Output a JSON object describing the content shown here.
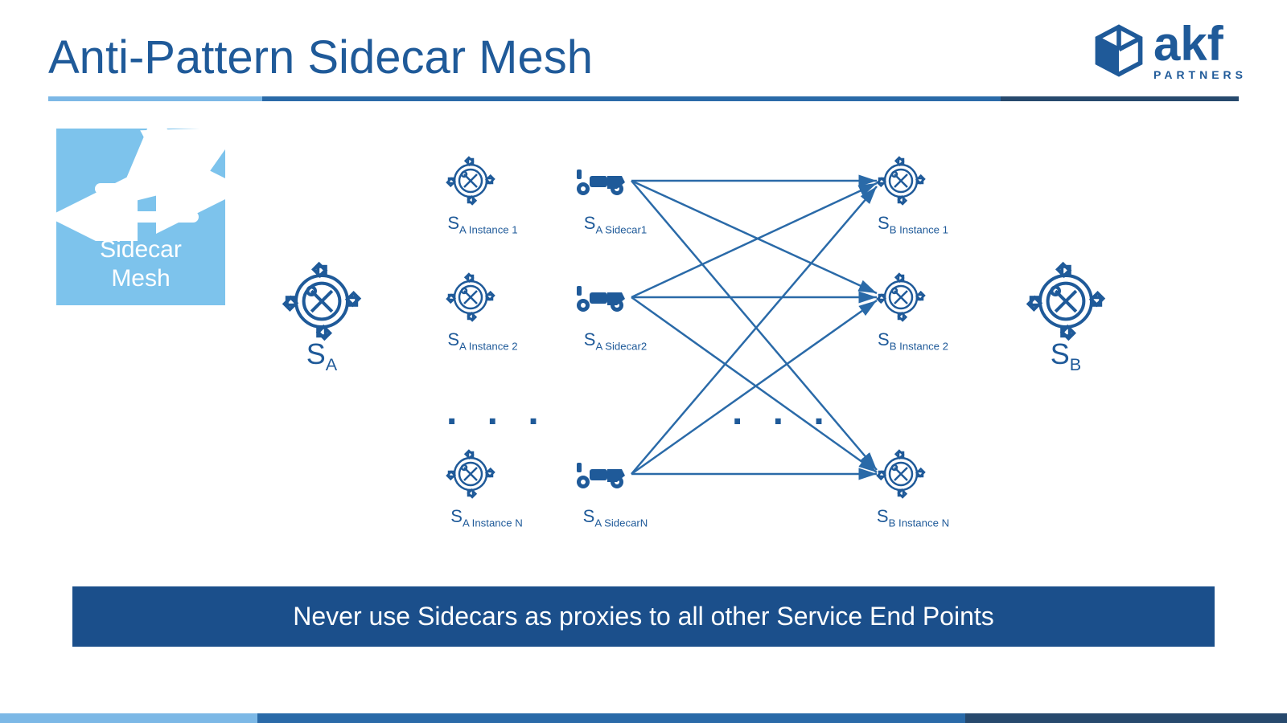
{
  "title": "Anti-Pattern Sidecar Mesh",
  "logo": {
    "name": "akf",
    "sub": "PARTNERS"
  },
  "box": {
    "line1": "Sidecar",
    "line2": "Mesh"
  },
  "labels": {
    "sa": "S",
    "sa_sub": "A",
    "sb": "S",
    "sb_sub": "B",
    "sa_inst1": "A Instance 1",
    "sa_inst2": "A Instance 2",
    "sa_instN": "A Instance N",
    "sa_sc1": "A Sidecar1",
    "sa_sc2": "A Sidecar2",
    "sa_scN": "A SidecarN",
    "sb_inst1": "B Instance 1",
    "sb_inst2": "B Instance 2",
    "sb_instN": "B Instance N"
  },
  "banner": "Never use Sidecars as proxies to all other Service End Points",
  "dots": ". . .",
  "diagram": {
    "nodes": {
      "SA": {
        "type": "service"
      },
      "SA_Instance_1": {
        "type": "instance"
      },
      "SA_Instance_2": {
        "type": "instance"
      },
      "SA_Instance_N": {
        "type": "instance"
      },
      "SA_Sidecar1": {
        "type": "sidecar"
      },
      "SA_Sidecar2": {
        "type": "sidecar"
      },
      "SA_SidecarN": {
        "type": "sidecar"
      },
      "SB_Instance_1": {
        "type": "instance"
      },
      "SB_Instance_2": {
        "type": "instance"
      },
      "SB_Instance_N": {
        "type": "instance"
      },
      "SB": {
        "type": "service"
      }
    },
    "edges": [
      [
        "SA_Sidecar1",
        "SB_Instance_1"
      ],
      [
        "SA_Sidecar1",
        "SB_Instance_2"
      ],
      [
        "SA_Sidecar1",
        "SB_Instance_N"
      ],
      [
        "SA_Sidecar2",
        "SB_Instance_1"
      ],
      [
        "SA_Sidecar2",
        "SB_Instance_2"
      ],
      [
        "SA_Sidecar2",
        "SB_Instance_N"
      ],
      [
        "SA_SidecarN",
        "SB_Instance_1"
      ],
      [
        "SA_SidecarN",
        "SB_Instance_2"
      ],
      [
        "SA_SidecarN",
        "SB_Instance_N"
      ]
    ]
  }
}
